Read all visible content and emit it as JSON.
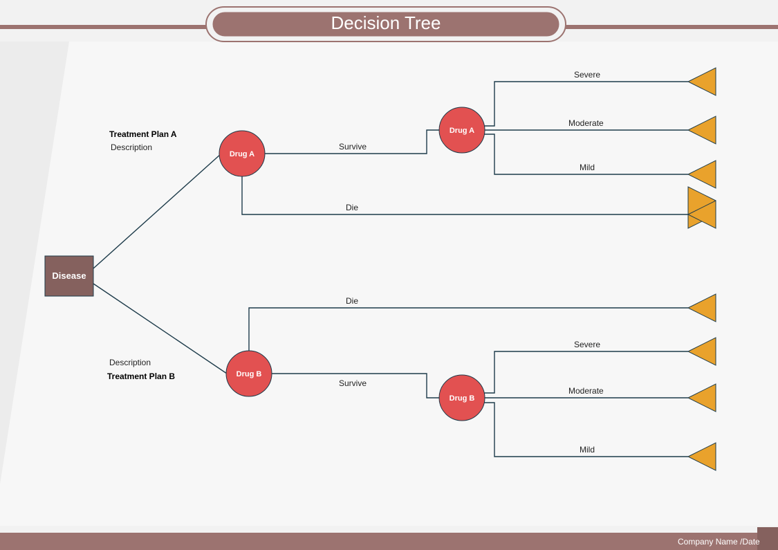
{
  "title": "Decision Tree",
  "root": {
    "label": "Disease"
  },
  "planA": {
    "title": "Treatment Plan A",
    "desc": "Description",
    "drug_first": "Drug A",
    "survive": "Survive",
    "die": "Die",
    "drug_second": "Drug A",
    "outcomes": {
      "severe": "Severe",
      "moderate": "Moderate",
      "mild": "Mild"
    }
  },
  "planB": {
    "title": "Treatment Plan B",
    "desc": "Description",
    "drug_first": "Drug  B",
    "survive": "Survive",
    "die": "Die",
    "drug_second": "Drug  B",
    "outcomes": {
      "severe": "Severe",
      "moderate": "Moderate",
      "mild": "Mild"
    }
  },
  "footer": "Company Name /Date",
  "colors": {
    "brand": "#9c7370",
    "accent_red": "#e25151",
    "accent_orange": "#e9a22c",
    "edge": "#1d3b4a"
  }
}
